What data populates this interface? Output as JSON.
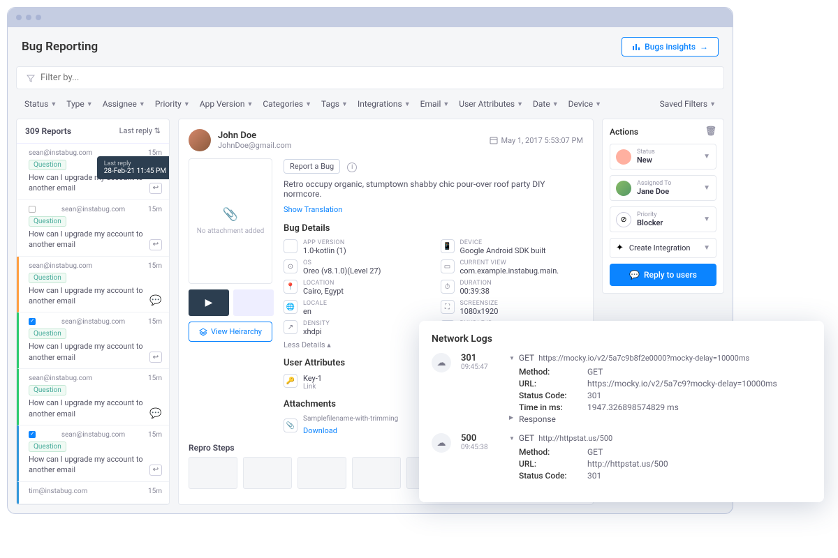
{
  "header": {
    "title": "Bug Reporting",
    "insights_btn": "Bugs insights"
  },
  "filter_placeholder": "Filter by...",
  "filters": [
    "Status",
    "Type",
    "Assignee",
    "Priority",
    "App Version",
    "Categories",
    "Tags",
    "Integrations",
    "Email",
    "User Attributes",
    "Date",
    "Device"
  ],
  "saved_filters": "Saved Filters",
  "reports": {
    "count": "309 Reports",
    "sort": "Last reply",
    "tooltip_title": "Last reply",
    "tooltip_val": "28-Feb-21 11:45 PM",
    "items": [
      {
        "email": "sean@instabug.com",
        "time": "15m",
        "badge": "Question",
        "text": "How can I upgrade my account to another email",
        "sel": false,
        "icon": "reply",
        "trunc": true
      },
      {
        "email": "sean@instabug.com",
        "time": "15m",
        "badge": "Question",
        "text": "How can I upgrade my account to another email",
        "sel": false,
        "icon": "reply",
        "chk": true
      },
      {
        "email": "sean@instabug.com",
        "time": "15m",
        "badge": "Question",
        "text": "How can I upgrade my account to another email",
        "sel": "sel",
        "icon": "chat"
      },
      {
        "email": "sean@instabug.com",
        "time": "15m",
        "badge": "Question",
        "text": "How can I upgrade my account to another email",
        "sel": "green",
        "icon": "reply",
        "chkon": true
      },
      {
        "email": "sean@instabug.com",
        "time": "15m",
        "badge": "Question",
        "text": "How can I upgrade my account to another email",
        "sel": "green",
        "icon": "chat"
      },
      {
        "email": "sean@instabug.com",
        "time": "15m",
        "badge": "Question",
        "text": "How can I upgrade my account to another email",
        "sel": "blue",
        "icon": "reply",
        "chkon": true
      },
      {
        "email": "tim@instabug.com",
        "time": "15m",
        "badge": "",
        "text": "",
        "sel": "blue"
      }
    ]
  },
  "detail": {
    "name": "John Doe",
    "email": "JohnDoe@gmail.com",
    "date": "May 1, 2017 5:53:07 PM",
    "chip": "Report a Bug",
    "desc": "Retro occupy organic, stumptown shabby chic pour-over roof party DIY normcore.",
    "translate": "Show Translation",
    "no_attach": "No attachment added",
    "bug_details_title": "Bug Details",
    "less_details": "Less Details",
    "details": [
      {
        "label": "APP VERSION",
        "val": "1.0-kotlin (1)"
      },
      {
        "label": "DEVICE",
        "val": "Google Android SDK built"
      },
      {
        "label": "OS",
        "val": "Oreo (v8.1.0)(Level 27)"
      },
      {
        "label": "CURRENT VIEW",
        "val": "com.example.instabug.main."
      },
      {
        "label": "LOCATION",
        "val": "Cairo, Egypt"
      },
      {
        "label": "DURATION",
        "val": "00:39:38"
      },
      {
        "label": "LOCALE",
        "val": "en"
      },
      {
        "label": "SCREENSIZE",
        "val": "1080x1920"
      },
      {
        "label": "DENSITY",
        "val": "xhdpi"
      },
      {
        "label": "BUNDLE ID",
        "val": ""
      }
    ],
    "view_hierarchy": "View Heirarchy",
    "user_attrs_title": "User Attributes",
    "ua_key": "Key-1",
    "ua_val": "Link",
    "attachments_title": "Attachments",
    "attach_name": "Samplefilename-with-trimming",
    "download": "Download",
    "repro_title": "Repro Steps"
  },
  "actions": {
    "title": "Actions",
    "status": {
      "label": "Status",
      "val": "New"
    },
    "assigned": {
      "label": "Assigned To",
      "val": "Jane Doe"
    },
    "priority": {
      "label": "Priority",
      "val": "Blocker"
    },
    "integration": "Create Integration",
    "reply": "Reply to users"
  },
  "netlog": {
    "title": "Network Logs",
    "rows": [
      {
        "code": "301",
        "time": "09:45:47",
        "method": "GET",
        "url_short": "https://mocky.io/v2/5a7c9b8f2e0000?mocky-delay=10000ms",
        "kv": [
          [
            "Method:",
            "GET"
          ],
          [
            "URL:",
            "https://mocky.io/v2/5a7c9?mocky-delay=10000ms"
          ],
          [
            "Status Code:",
            "301"
          ],
          [
            "Time in ms:",
            "1947.326898574829 ms"
          ]
        ],
        "response": "Response"
      },
      {
        "code": "500",
        "time": "09:45:38",
        "method": "GET",
        "url_short": "http://httpstat.us/500",
        "kv": [
          [
            "Method:",
            "GET"
          ],
          [
            "URL:",
            "http://httpstat.us/500"
          ],
          [
            "Status Code:",
            "301"
          ]
        ]
      }
    ]
  }
}
